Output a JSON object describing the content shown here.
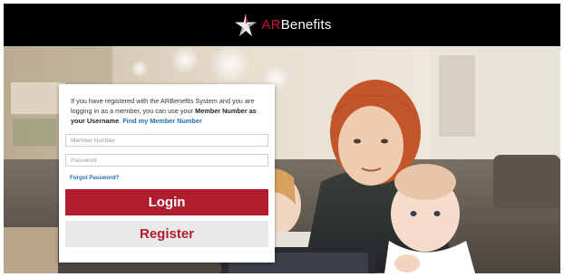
{
  "header": {
    "brand_prefix": "AR",
    "brand_suffix": "Benefits",
    "logo_icon": "star-icon",
    "background": "#000000"
  },
  "login_card": {
    "intro_part1": "If you have registered with the ARBenefits System and you are logging in as a member, you can use your ",
    "intro_bold": "Member Number as your Username",
    "intro_part2": ". ",
    "intro_link": "Find my Member Number",
    "member_number_placeholder": "Member Number",
    "member_number_value": "",
    "password_placeholder": "Password",
    "password_value": "",
    "forgot_password_label": "Forgot Password?",
    "login_label": "Login",
    "register_label": "Register"
  },
  "colors": {
    "brand_red": "#b01e2e",
    "link_blue": "#1f6fb5",
    "register_bg": "#e9e9e9"
  }
}
